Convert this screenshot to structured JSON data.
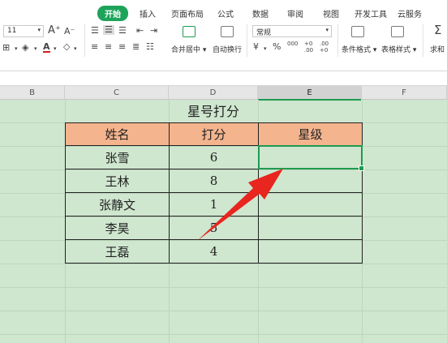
{
  "ribbon": {
    "tabs": [
      {
        "label": "开始",
        "active": true
      },
      {
        "label": "插入",
        "active": false
      },
      {
        "label": "页面布局",
        "active": false
      },
      {
        "label": "公式",
        "active": false
      },
      {
        "label": "数据",
        "active": false
      },
      {
        "label": "审阅",
        "active": false
      },
      {
        "label": "视图",
        "active": false
      },
      {
        "label": "开发工具",
        "active": false
      },
      {
        "label": "云服务",
        "active": false
      }
    ],
    "font_size": "11",
    "merge_center": "合并居中",
    "wrap_text": "自动换行",
    "number_format": "常规",
    "conditional_format": "条件格式",
    "table_style": "表格样式",
    "sum": "求和",
    "percent": "%",
    "thousands": "000",
    "inc_decimal": "+0\n.00",
    "dec_decimal": ".00\n+0"
  },
  "sheet": {
    "columns": [
      "B",
      "C",
      "D",
      "E",
      "F"
    ],
    "selected_column": "E",
    "title": "星号打分",
    "headers": [
      "姓名",
      "打分",
      "星级"
    ],
    "rows": [
      {
        "name": "张雪",
        "score": "6",
        "stars": ""
      },
      {
        "name": "王林",
        "score": "8",
        "stars": ""
      },
      {
        "name": "张静文",
        "score": "1",
        "stars": ""
      },
      {
        "name": "李昊",
        "score": "5",
        "stars": ""
      },
      {
        "name": "王磊",
        "score": "4",
        "stars": ""
      }
    ]
  },
  "colors": {
    "accent": "#1ea35a",
    "header_fill": "#f4b48e",
    "sheet_bg": "#cfe6cf",
    "arrow": "#e8251f"
  }
}
